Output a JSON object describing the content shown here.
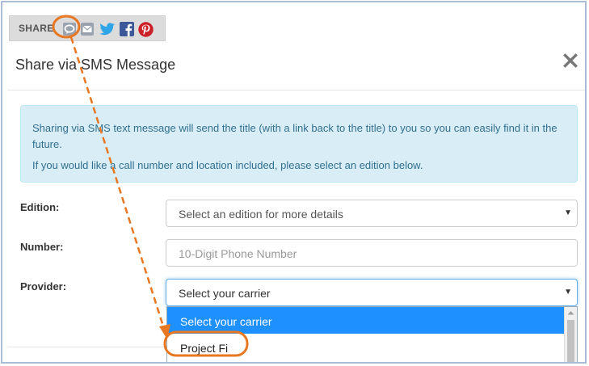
{
  "share_bar": {
    "label": "SHARE",
    "icons": [
      "sms-icon",
      "email-icon",
      "twitter-icon",
      "facebook-icon",
      "pinterest-icon"
    ]
  },
  "modal": {
    "title": "Share via SMS Message",
    "close_icon": "close-icon"
  },
  "info": {
    "line1": "Sharing via SMS text message will send the title (with a link back to the title) to you so you can easily find it in the future.",
    "line2": "If you would like a call number and location included, please select an edition below."
  },
  "form": {
    "edition_label": "Edition:",
    "edition_value": "Select an edition for more details",
    "number_label": "Number:",
    "number_placeholder": "10-Digit Phone Number",
    "provider_label": "Provider:",
    "provider_value": "Select your carrier"
  },
  "dropdown": {
    "options": [
      "Select your carrier",
      "Project Fi"
    ]
  },
  "colors": {
    "annotation": "#e87722",
    "selected_option": "#1e90ff",
    "info_bg": "#d9edf7"
  }
}
